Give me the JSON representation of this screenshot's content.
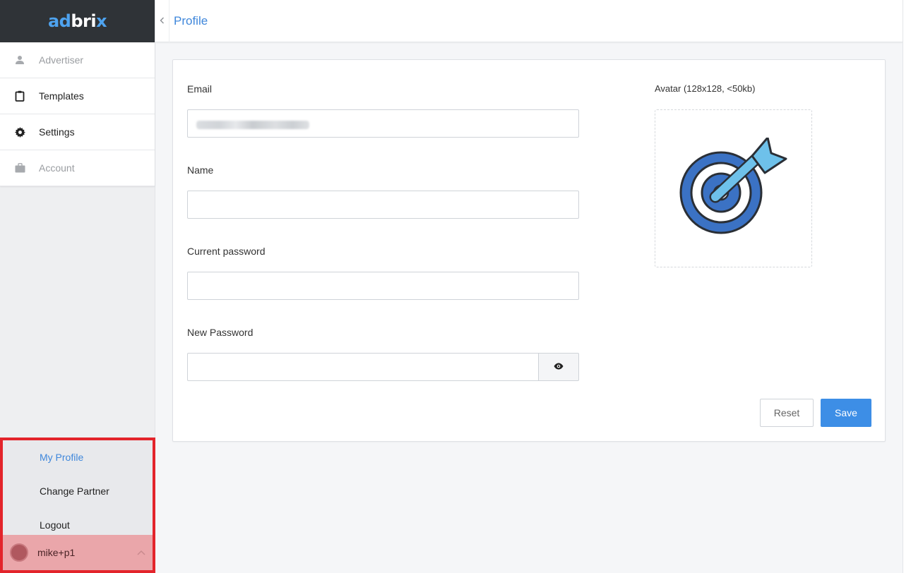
{
  "logo": {
    "part1": "ad",
    "part2": "bri",
    "part3": "x"
  },
  "sidebar": {
    "items": [
      {
        "label": "Advertiser",
        "icon": "user-icon",
        "state": "disabled"
      },
      {
        "label": "Templates",
        "icon": "clipboard-icon",
        "state": "enabled"
      },
      {
        "label": "Settings",
        "icon": "gear-icon",
        "state": "enabled"
      },
      {
        "label": "Account",
        "icon": "briefcase-icon",
        "state": "disabled"
      }
    ]
  },
  "user_menu": {
    "items": [
      {
        "label": "My Profile",
        "selected": true
      },
      {
        "label": "Change Partner",
        "selected": false
      },
      {
        "label": "Logout",
        "selected": false
      }
    ],
    "username": "mike+p1",
    "chevron_icon": "chevron-up-icon"
  },
  "header": {
    "title": "Profile",
    "collapse_icon": "chevron-left-icon"
  },
  "form": {
    "email_label": "Email",
    "email_value": "",
    "name_label": "Name",
    "name_value": "",
    "current_password_label": "Current password",
    "current_password_value": "",
    "new_password_label": "New Password",
    "new_password_value": "",
    "visibility_icon": "eye-icon",
    "avatar_label": "Avatar (128x128, <50kb)",
    "avatar_icon": "target-dart-icon"
  },
  "buttons": {
    "reset_label": "Reset",
    "save_label": "Save"
  },
  "colors": {
    "accent": "#3f87db",
    "save_button": "#3d8ee6",
    "highlight_border": "#e3242b",
    "user_bar": "#eaa6aa",
    "logo_bar": "#2f3337"
  }
}
